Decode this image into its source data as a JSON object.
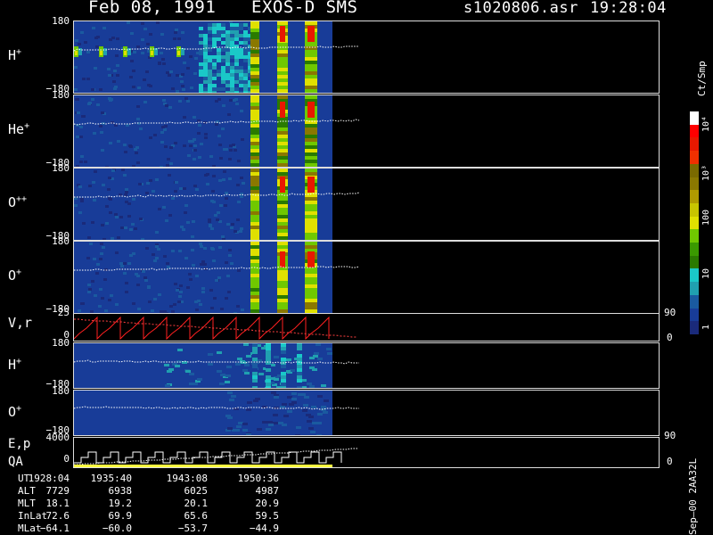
{
  "header": {
    "date": "Feb 08, 1991",
    "instrument": "EXOS-D SMS",
    "filename": "s1020806.asr",
    "time": "19:28:04"
  },
  "colorbar": {
    "title": "Ct/Smp",
    "ticks": [
      "10⁴",
      "10³",
      "100",
      "10",
      "1"
    ],
    "colors": [
      "#ffffff",
      "#ff0000",
      "#e81800",
      "#f03000",
      "#7a6a00",
      "#8a7800",
      "#b09a00",
      "#c8c400",
      "#e0e000",
      "#70c800",
      "#3a9a00",
      "#2a7a00",
      "#1ac8c8",
      "#20a0b0",
      "#1a5aa0",
      "#183c98",
      "#1a2a7a"
    ]
  },
  "panels": [
    {
      "id": "h-plus",
      "label": "H",
      "sup": "+",
      "ymax": "180",
      "ymin": "−180"
    },
    {
      "id": "he-plus",
      "label": "He",
      "sup": "+",
      "ymax": "180",
      "ymin": "−180"
    },
    {
      "id": "o-plusplus",
      "label": "O",
      "sup": "++",
      "ymax": "180",
      "ymin": "−180"
    },
    {
      "id": "o-plus",
      "label": "O",
      "sup": "+",
      "ymax": "180",
      "ymin": "−180"
    }
  ],
  "vr_panel": {
    "label": "V,r",
    "ymax": "25",
    "ymin": "0",
    "right_top": "90",
    "right_bottom": "0"
  },
  "h_low_panel": {
    "label": "H",
    "sup": "+",
    "ymax": "180",
    "ymin": "−180"
  },
  "o_low_panel": {
    "label": "O",
    "sup": "+",
    "ymax": "180",
    "ymin": "−180"
  },
  "ep_panel": {
    "label1": "E,p",
    "label2": "QA",
    "ymax": "4000",
    "ymin": "0",
    "right_top": "90",
    "right_bottom": "0"
  },
  "ephemeris": {
    "rows": [
      {
        "name": "UT",
        "values": [
          "1928:04",
          "1935:40",
          "1943:08",
          "1950:36"
        ]
      },
      {
        "name": "ALT",
        "values": [
          "7729",
          "6938",
          "6025",
          "4987"
        ]
      },
      {
        "name": "MLT",
        "values": [
          "18.1",
          "19.2",
          "20.1",
          "20.9"
        ]
      },
      {
        "name": "InLat",
        "values": [
          "72.6",
          "69.9",
          "65.6",
          "59.5"
        ]
      },
      {
        "name": "MLat",
        "values": [
          "−64.1",
          "−60.0",
          "−53.7",
          "−44.9"
        ]
      }
    ]
  },
  "footer_code": "Sep–00 2AA32L",
  "chart_data": {
    "type": "heatmap",
    "title": "EXOS-D SMS",
    "x": [
      "1928:04",
      "1935:40",
      "1943:08",
      "1950:36"
    ],
    "panels": [
      "H+",
      "He+",
      "O++",
      "O+",
      "V,r",
      "H+",
      "O+",
      "E,p QA"
    ],
    "colorbar_label": "Ct/Smp",
    "colorbar_range": [
      1,
      10000
    ],
    "colorbar_scale": "log"
  }
}
